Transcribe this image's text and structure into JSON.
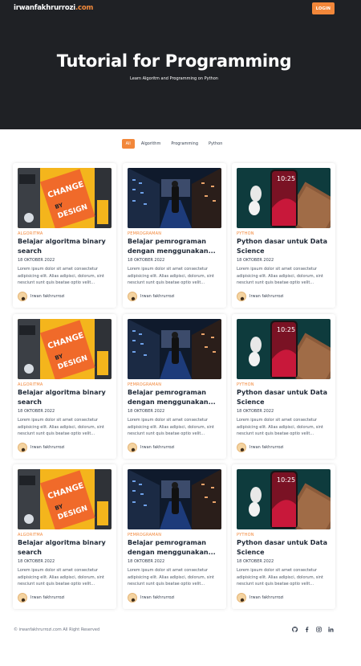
{
  "header": {
    "logo_name": "irwanfakhrurrozi",
    "logo_domain": ".com",
    "login_label": "LOGIN",
    "title": "Tutorial for Programming",
    "subtitle": "Learn Algoritm and Programming on Python"
  },
  "filters": [
    "All",
    "Algorithm",
    "Programming",
    "Python"
  ],
  "active_filter": "All",
  "accent_color": "#f2873a",
  "cards": [
    {
      "image": "change-by-design",
      "category": "ALGORITMA",
      "title": "Belajar algoritma binary search",
      "date": "18 OKTOBER 2022",
      "excerpt": "Lorem ipsum dolor sit amet consectetur adipisicing elit. Alias adipisci, dolorum, sint nesciunt sunt quis beatae optio velit...",
      "author": "Irwan fakhrurrozi"
    },
    {
      "image": "server-room",
      "category": "PEMROGRAMAN",
      "title": "Belajar pemrograman dengan menggunakan...",
      "date": "18 OKTOBER 2022",
      "excerpt": "Lorem ipsum dolor sit amet consectetur adipisicing elit. Alias adipisci, dolorum, sint nesciunt sunt quis beatae optio velit...",
      "author": "Irwan fakhrurrozi"
    },
    {
      "image": "phone-earbuds",
      "category": "PYTHON",
      "title": "Python dasar untuk Data Science",
      "date": "18 OKTOBER 2022",
      "excerpt": "Lorem ipsum dolor sit amet consectetur adipisicing elit. Alias adipisci, dolorum, sint nesciunt sunt quis beatae optio velit...",
      "author": "Irwan fakhrurrozi"
    },
    {
      "image": "change-by-design",
      "category": "ALGORITMA",
      "title": "Belajar algoritma binary search",
      "date": "18 OKTOBER 2022",
      "excerpt": "Lorem ipsum dolor sit amet consectetur adipisicing elit. Alias adipisci, dolorum, sint nesciunt sunt quis beatae optio velit...",
      "author": "Irwan fakhrurrozi"
    },
    {
      "image": "server-room",
      "category": "PEMROGRAMAN",
      "title": "Belajar pemrograman dengan menggunakan...",
      "date": "18 OKTOBER 2022",
      "excerpt": "Lorem ipsum dolor sit amet consectetur adipisicing elit. Alias adipisci, dolorum, sint nesciunt sunt quis beatae optio velit...",
      "author": "Irwan fakhrurrozi"
    },
    {
      "image": "phone-earbuds",
      "category": "PYTHON",
      "title": "Python dasar untuk Data Science",
      "date": "18 OKTOBER 2022",
      "excerpt": "Lorem ipsum dolor sit amet consectetur adipisicing elit. Alias adipisci, dolorum, sint nesciunt sunt quis beatae optio velit...",
      "author": "Irwan fakhrurrozi"
    },
    {
      "image": "change-by-design",
      "category": "ALGORITMA",
      "title": "Belajar algoritma binary search",
      "date": "18 OKTOBER 2022",
      "excerpt": "Lorem ipsum dolor sit amet consectetur adipisicing elit. Alias adipisci, dolorum, sint nesciunt sunt quis beatae optio velit...",
      "author": "Irwan fakhrurrozi"
    },
    {
      "image": "server-room",
      "category": "PEMROGRAMAN",
      "title": "Belajar pemrograman dengan menggunakan...",
      "date": "18 OKTOBER 2022",
      "excerpt": "Lorem ipsum dolor sit amet consectetur adipisicing elit. Alias adipisci, dolorum, sint nesciunt sunt quis beatae optio velit...",
      "author": "Irwan fakhrurrozi"
    },
    {
      "image": "phone-earbuds",
      "category": "PYTHON",
      "title": "Python dasar untuk Data Science",
      "date": "18 OKTOBER 2022",
      "excerpt": "Lorem ipsum dolor sit amet consectetur adipisicing elit. Alias adipisci, dolorum, sint nesciunt sunt quis beatae optio velit...",
      "author": "Irwan fakhrurrozi"
    }
  ],
  "footer": {
    "copyright": "© irwanfakhrurrozi.com All Right Reserved",
    "socials": [
      "github-icon",
      "facebook-icon",
      "instagram-icon",
      "linkedin-icon"
    ]
  }
}
